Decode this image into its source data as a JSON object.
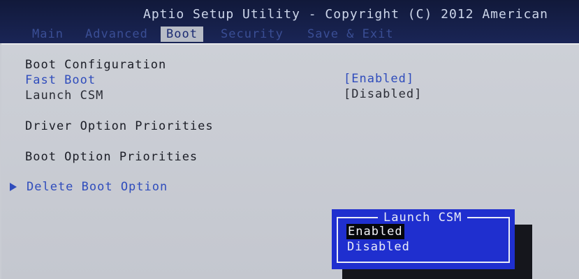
{
  "window": {
    "title": "Aptio Setup Utility - Copyright (C) 2012 American"
  },
  "menu": {
    "tabs": [
      {
        "label": "Main"
      },
      {
        "label": "Advanced"
      },
      {
        "label": "Boot"
      },
      {
        "label": "Security"
      },
      {
        "label": "Save & Exit"
      }
    ],
    "active_tab": "Boot"
  },
  "boot": {
    "section_title": "Boot Configuration",
    "fast_boot": {
      "label": "Fast Boot",
      "value": "[Enabled]"
    },
    "launch_csm": {
      "label": "Launch CSM",
      "value": "[Disabled]"
    },
    "driver_option_priorities": "Driver Option Priorities",
    "boot_option_priorities": "Boot Option Priorities",
    "delete_boot_option": "Delete Boot Option"
  },
  "popup": {
    "title": "Launch CSM",
    "options": [
      "Enabled",
      "Disabled"
    ],
    "selected": "Enabled"
  },
  "colors": {
    "header": "#11193a",
    "panel": "#c9ccd3",
    "accent_blue": "#2f4cbc",
    "popup_bg": "#1f2fcf"
  }
}
